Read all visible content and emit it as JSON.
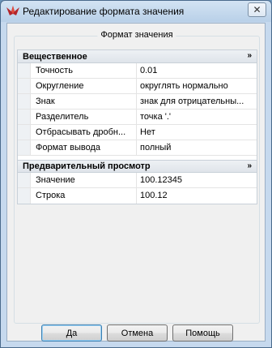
{
  "window": {
    "title": "Редактирование формата значения",
    "close_symbol": "✕",
    "app_icon": "ashampoo-like-red-bird-icon"
  },
  "group": {
    "legend": "Формат значения"
  },
  "sections": [
    {
      "title": "Вещественное",
      "collapse_symbol": "»",
      "rows": [
        {
          "name": "Точность",
          "value": "0.01"
        },
        {
          "name": "Округление",
          "value": "округлять нормально"
        },
        {
          "name": "Знак",
          "value": "знак для отрицательны..."
        },
        {
          "name": "Разделитель",
          "value": "точка '.'"
        },
        {
          "name": "Отбрасывать дробн...",
          "value": "Нет"
        },
        {
          "name": "Формат вывода",
          "value": "полный"
        }
      ]
    },
    {
      "title": "Предварительный просмотр",
      "collapse_symbol": "»",
      "rows": [
        {
          "name": "Значение",
          "value": "100.12345"
        },
        {
          "name": "Строка",
          "value": "100.12"
        }
      ]
    }
  ],
  "buttons": {
    "ok": "Да",
    "cancel": "Отмена",
    "help": "Помощь"
  },
  "colors": {
    "title_bar": "#b9d0e8",
    "default_button_border": "#3c7fb1"
  }
}
